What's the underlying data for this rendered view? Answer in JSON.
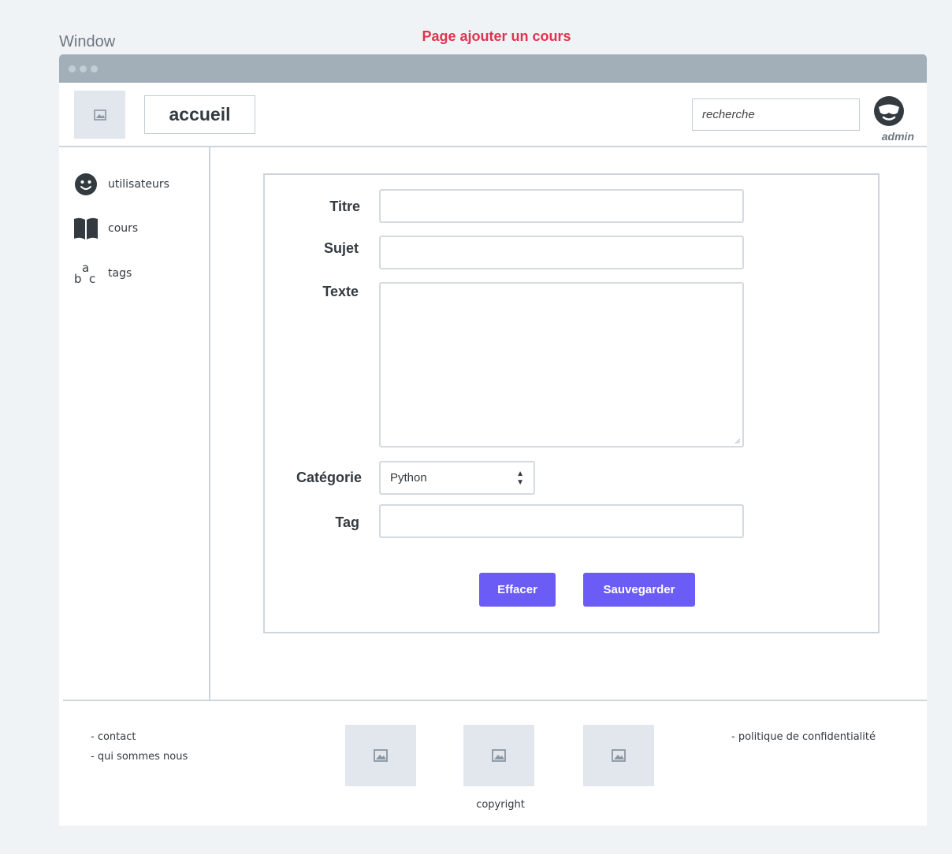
{
  "window_label": "Window",
  "page_title": "Page ajouter un cours",
  "colors": {
    "page_title": "#e0334e",
    "titlebar": "#a2afb9",
    "button": "#6b5cf6",
    "placeholder_bg": "#e1e7ed",
    "border": "#cdd5dc"
  },
  "header": {
    "logo_icon": "image-icon",
    "home_label": "accueil",
    "search_placeholder": "recherche",
    "user_icon": "user-avatar-icon",
    "user_label": "admin"
  },
  "sidebar": {
    "items": [
      {
        "icon": "smiley-icon",
        "label": "utilisateurs"
      },
      {
        "icon": "book-icon",
        "label": "cours"
      },
      {
        "icon": "abc-icon",
        "label": "tags"
      }
    ]
  },
  "form": {
    "title_label": "Titre",
    "subject_label": "Sujet",
    "text_label": "Texte",
    "category_label": "Catégorie",
    "category_value": "Python",
    "tag_label": "Tag",
    "clear_button": "Effacer",
    "save_button": "Sauvegarder"
  },
  "footer": {
    "contact": "- contact",
    "about": "- qui sommes nous",
    "privacy": "- politique de confidentialité",
    "copyright": "copyright"
  }
}
